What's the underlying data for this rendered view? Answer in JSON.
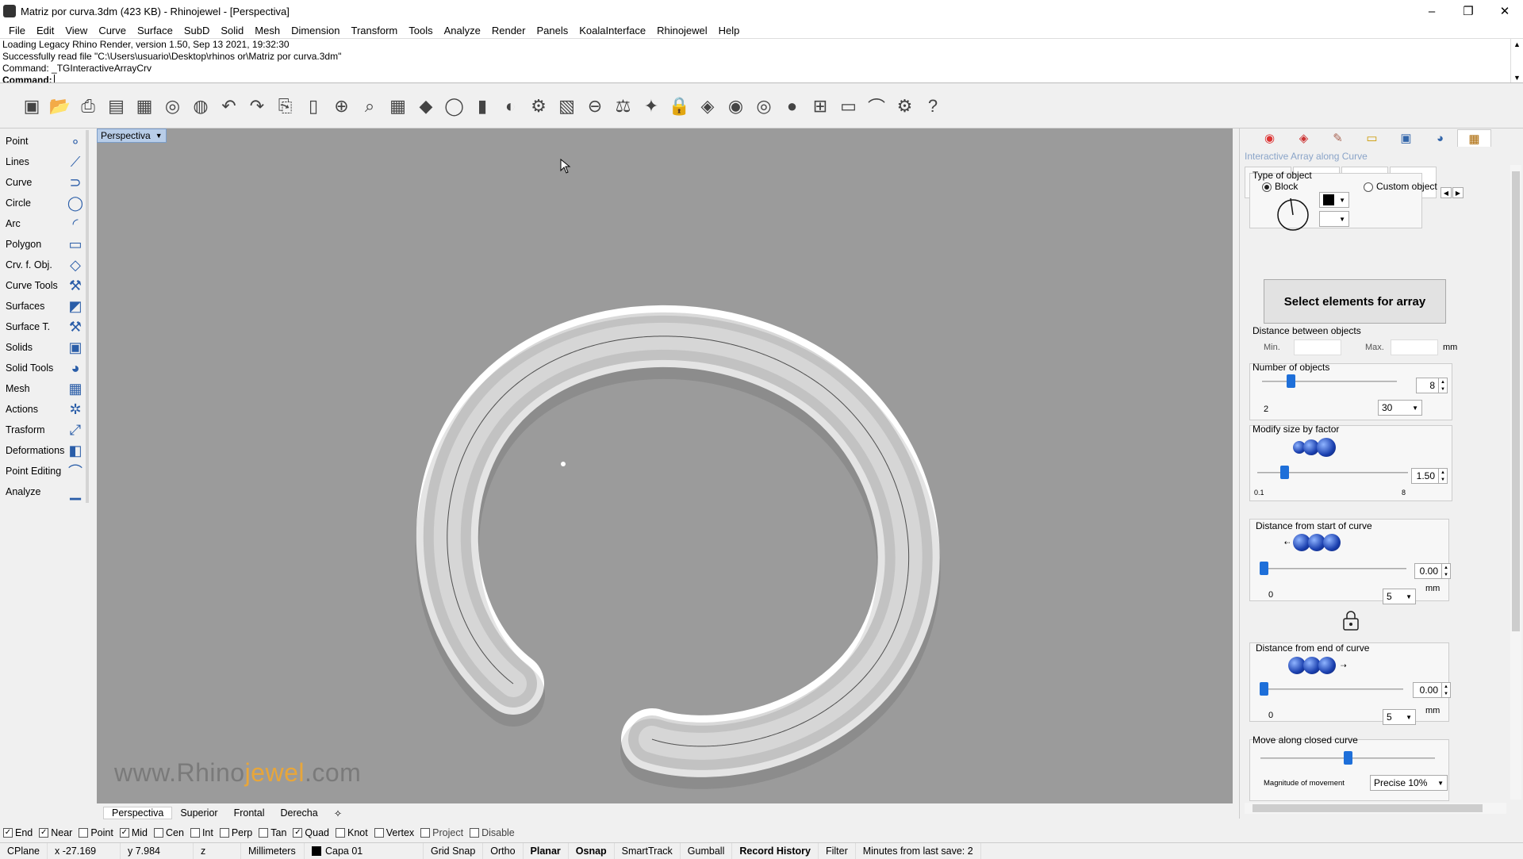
{
  "window": {
    "title": "Matriz por curva.3dm (423 KB) - Rhinojewel - [Perspectiva]",
    "min": "–",
    "max": "❐",
    "close": "✕"
  },
  "menu": [
    "File",
    "Edit",
    "View",
    "Curve",
    "Surface",
    "SubD",
    "Solid",
    "Mesh",
    "Dimension",
    "Transform",
    "Tools",
    "Analyze",
    "Render",
    "Panels",
    "KoalaInterface",
    "Rhinojewel",
    "Help"
  ],
  "command": {
    "history": [
      "Loading Legacy Rhino Render, version 1.50, Sep 13 2021, 19:32:30",
      "Successfully read file \"C:\\Users\\usuario\\Desktop\\rhinos or\\Matriz por curva.3dm\"",
      "Command: _TGInteractiveArrayCrv"
    ],
    "prompt": "Command:"
  },
  "toolbar_icons": [
    "new-icon",
    "open-icon",
    "print-icon",
    "save-icon",
    "save-as-icon",
    "ring-icon",
    "gem-ring-icon",
    "undo-icon",
    "redo-icon",
    "copy-icon",
    "paste-icon",
    "zoom-extents-icon",
    "zoom-icon",
    "viewports-icon",
    "gem-icon",
    "ring-profile-icon",
    "pendant-icon",
    "bracelet-icon",
    "chain-icon",
    "texture-icon",
    "measure-icon",
    "weight-icon",
    "lightbulb-icon",
    "lock-icon",
    "material-icon",
    "color-wheel-icon",
    "render-sphere-icon",
    "blue-sphere-icon",
    "dimension-icon",
    "ruler-icon",
    "curve-tool-icon",
    "settings-icon",
    "help-icon"
  ],
  "toolbar_glyphs": [
    "▣",
    "📂",
    "⎙",
    "▤",
    "▦",
    "◎",
    "◍",
    "↶",
    "↷",
    "⎘",
    "▯",
    "⊕",
    "⌕",
    "▦",
    "◆",
    "◯",
    "▮",
    "◐",
    "⚙",
    "▧",
    "⊖",
    "⚖",
    "✦",
    "🔒",
    "◈",
    "◉",
    "◎",
    "●",
    "⊞",
    "▭",
    "⌒",
    "⚙",
    "?"
  ],
  "left_toolbar": [
    {
      "label": "Point",
      "icon": "point-icon",
      "glyph": "∘"
    },
    {
      "label": "Lines",
      "icon": "lines-icon",
      "glyph": "⟋"
    },
    {
      "label": "Curve",
      "icon": "curve-icon",
      "glyph": "⊃"
    },
    {
      "label": "Circle",
      "icon": "circle-icon",
      "glyph": "◯"
    },
    {
      "label": "Arc",
      "icon": "arc-icon",
      "glyph": "◜"
    },
    {
      "label": "Polygon",
      "icon": "polygon-icon",
      "glyph": "▭"
    },
    {
      "label": "Crv. f. Obj.",
      "icon": "curve-from-object-icon",
      "glyph": "◇"
    },
    {
      "label": "Curve Tools",
      "icon": "curve-tools-icon",
      "glyph": "⚒"
    },
    {
      "label": "Surfaces",
      "icon": "surfaces-icon",
      "glyph": "◩"
    },
    {
      "label": "Surface T.",
      "icon": "surface-tools-icon",
      "glyph": "⚒"
    },
    {
      "label": "Solids",
      "icon": "solids-icon",
      "glyph": "▣"
    },
    {
      "label": "Solid Tools",
      "icon": "solid-tools-icon",
      "glyph": "◕"
    },
    {
      "label": "Mesh",
      "icon": "mesh-icon",
      "glyph": "▦"
    },
    {
      "label": "Actions",
      "icon": "actions-icon",
      "glyph": "✲"
    },
    {
      "label": "Trasform",
      "icon": "transform-icon",
      "glyph": "⤢"
    },
    {
      "label": "Deformations",
      "icon": "deformations-icon",
      "glyph": "◧"
    },
    {
      "label": "Point Editing",
      "icon": "point-editing-icon",
      "glyph": "⌒"
    },
    {
      "label": "Analyze",
      "icon": "analyze-icon",
      "glyph": "▁"
    }
  ],
  "viewport": {
    "name": "Perspectiva",
    "watermark_a": "www.Rhino",
    "watermark_b": "jewel",
    "watermark_c": ".com"
  },
  "view_tabs": [
    "Perspectiva",
    "Superior",
    "Frontal",
    "Derecha",
    "✧"
  ],
  "osnaps": [
    {
      "label": "End",
      "checked": true
    },
    {
      "label": "Near",
      "checked": true
    },
    {
      "label": "Point",
      "checked": false
    },
    {
      "label": "Mid",
      "checked": true
    },
    {
      "label": "Cen",
      "checked": false
    },
    {
      "label": "Int",
      "checked": false
    },
    {
      "label": "Perp",
      "checked": false
    },
    {
      "label": "Tan",
      "checked": false
    },
    {
      "label": "Quad",
      "checked": true
    },
    {
      "label": "Knot",
      "checked": false
    },
    {
      "label": "Vertex",
      "checked": false
    },
    {
      "label": "Project",
      "checked": false
    },
    {
      "label": "Disable",
      "checked": false
    }
  ],
  "status": {
    "cplane": "CPlane",
    "x": "x -27.169",
    "y": "y 7.984",
    "z": "z",
    "units": "Millimeters",
    "layer": "Capa 01",
    "toggles": [
      {
        "label": "Grid Snap",
        "bold": false
      },
      {
        "label": "Ortho",
        "bold": false
      },
      {
        "label": "Planar",
        "bold": true
      },
      {
        "label": "Osnap",
        "bold": true
      },
      {
        "label": "SmartTrack",
        "bold": false
      },
      {
        "label": "Gumball",
        "bold": false
      },
      {
        "label": "Record History",
        "bold": true
      },
      {
        "label": "Filter",
        "bold": false
      }
    ],
    "last_save": "Minutes from last save: 2"
  },
  "panel": {
    "title": "Interactive Array along Curve",
    "type_of_object": "Type of object",
    "block": "Block",
    "custom_object": "Custom object",
    "select_button": "Select elements for array",
    "distance_between": "Distance between objects",
    "min": "Min.",
    "max": "Max.",
    "mm": "mm",
    "number_of_objects": "Number of objects",
    "num_value": "8",
    "num_min": "2",
    "num_max_select": "30",
    "num_level": 0.21,
    "modify_size": "Modify size by factor",
    "size_value": "1.50",
    "size_min": "0.1",
    "size_max": "8",
    "size_level": 0.18,
    "dist_start": "Distance from start of curve",
    "start_value": "0.00",
    "start_min": "0",
    "start_select": "5",
    "start_level": 0.0,
    "dist_end": "Distance from end of curve",
    "end_value": "0.00",
    "end_min": "0",
    "end_select": "5",
    "end_level": 0.0,
    "move_closed": "Move along closed curve",
    "move_level": 0.5,
    "magnitude": "Magnitude of movement",
    "magnitude_select": "Precise 10%"
  },
  "colors": {
    "viewport_bg": "#9b9b9b",
    "accent": "#1e6fd9",
    "watermark_accent": "#e8a63a"
  }
}
